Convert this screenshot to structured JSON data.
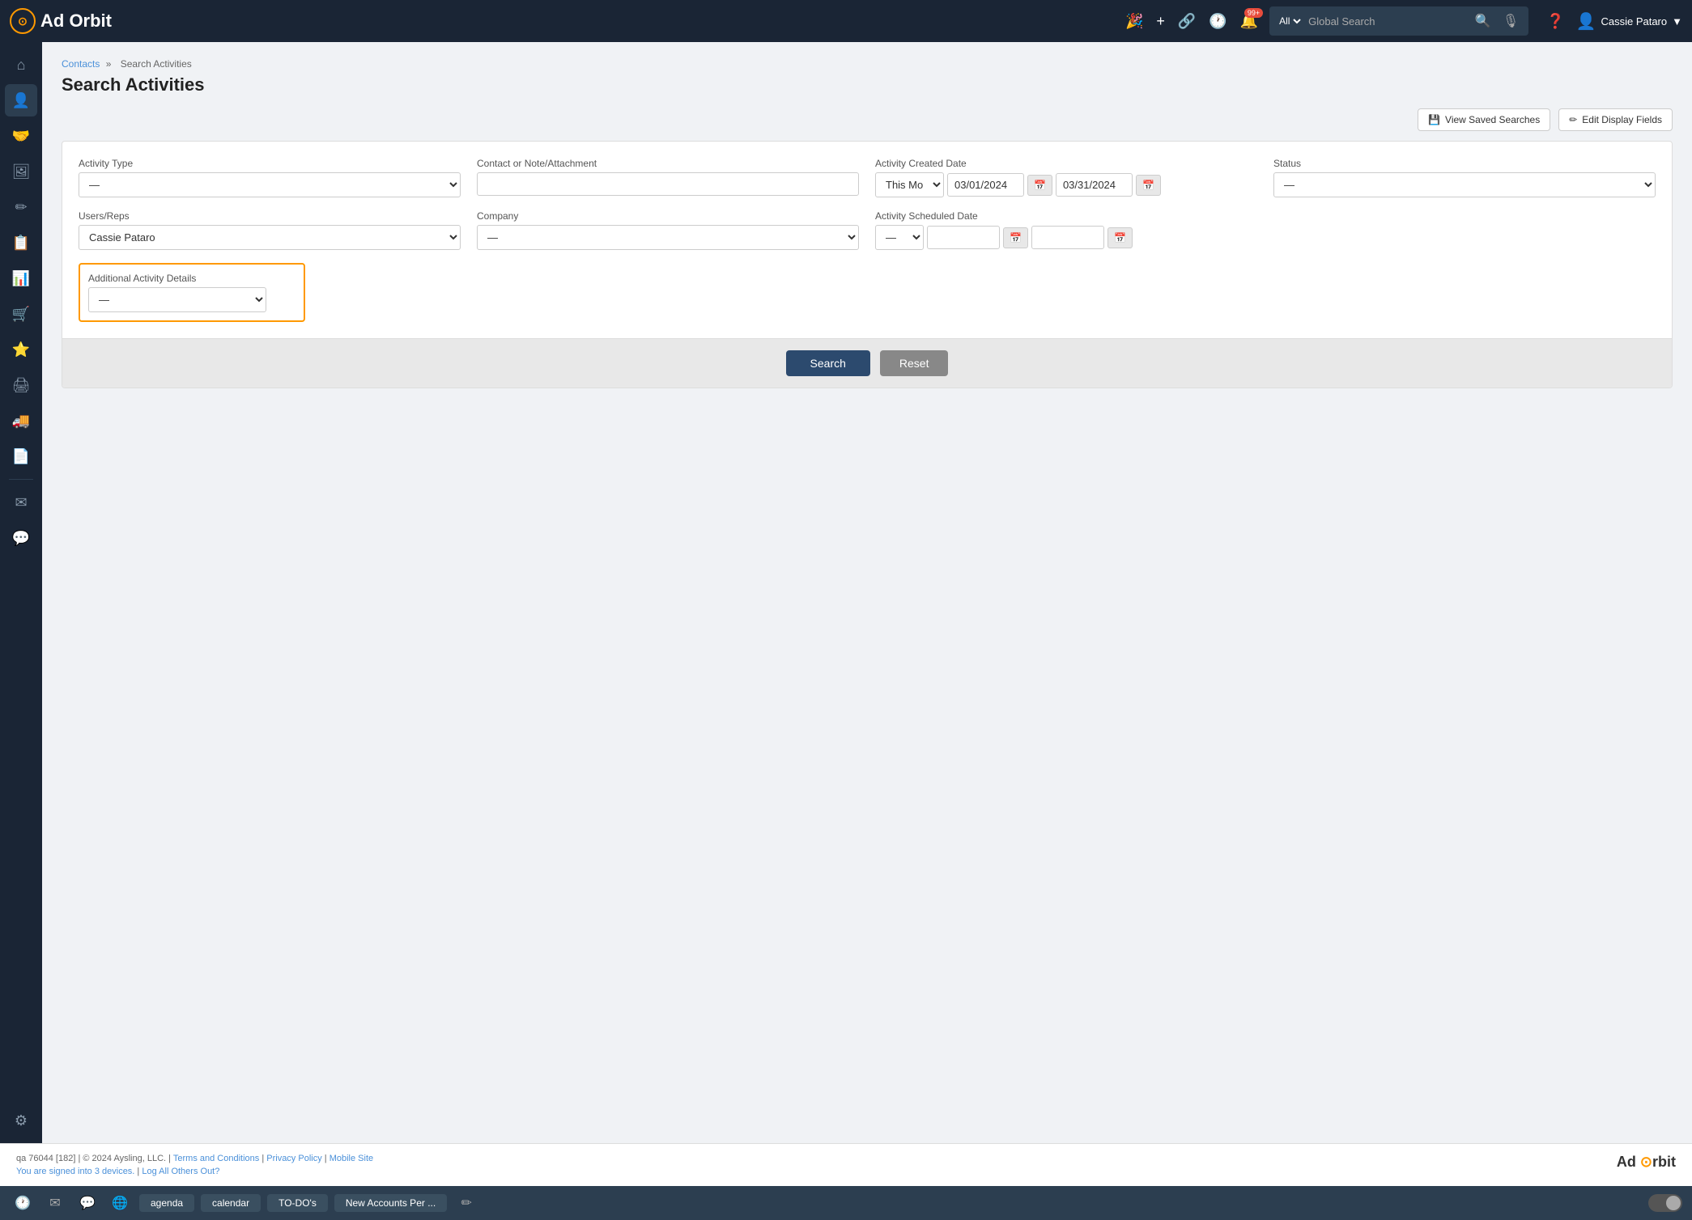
{
  "app": {
    "logo_text": "Ad Orbit",
    "logo_symbol": "⊙"
  },
  "topnav": {
    "search_placeholder": "Global Search",
    "search_filter": "All",
    "notification_count": "99+",
    "user_name": "Cassie Pataro",
    "help_icon": "?",
    "icons": [
      "🎉",
      "+",
      "🔗",
      "🕐"
    ]
  },
  "sidebar": {
    "items": [
      {
        "icon": "⌂",
        "name": "home",
        "active": false
      },
      {
        "icon": "👤",
        "name": "contacts",
        "active": true
      },
      {
        "icon": "🤝",
        "name": "deals",
        "active": false
      },
      {
        "icon": "🖼",
        "name": "media",
        "active": false
      },
      {
        "icon": "✏",
        "name": "edit",
        "active": false
      },
      {
        "icon": "📋",
        "name": "orders",
        "active": false
      },
      {
        "icon": "📊",
        "name": "reports",
        "active": false
      },
      {
        "icon": "🛒",
        "name": "cart",
        "active": false
      },
      {
        "icon": "⭐",
        "name": "favorites",
        "active": false
      },
      {
        "icon": "🖨",
        "name": "print",
        "active": false
      },
      {
        "icon": "🚚",
        "name": "delivery",
        "active": false
      },
      {
        "icon": "📄",
        "name": "document",
        "active": false
      },
      {
        "icon": "✉",
        "name": "mail",
        "active": false
      },
      {
        "icon": "💬",
        "name": "messages",
        "active": false
      },
      {
        "icon": "⚙",
        "name": "settings",
        "active": false
      }
    ]
  },
  "breadcrumb": {
    "parent": "Contacts",
    "separator": "»",
    "current": "Search Activities"
  },
  "page": {
    "title": "Search Activities"
  },
  "toolbar": {
    "view_saved_label": "View Saved Searches",
    "edit_display_label": "Edit Display Fields"
  },
  "form": {
    "activity_type": {
      "label": "Activity Type",
      "value": "—",
      "options": [
        "—"
      ]
    },
    "contact_note": {
      "label": "Contact or Note/Attachment",
      "placeholder": ""
    },
    "activity_created_date": {
      "label": "Activity Created Date",
      "preset": "This Mo",
      "start": "03/01/2024",
      "end": "03/31/2024"
    },
    "status": {
      "label": "Status",
      "value": "—",
      "options": [
        "—"
      ]
    },
    "users_reps": {
      "label": "Users/Reps",
      "value": "Cassie Pataro",
      "options": [
        "Cassie Pataro"
      ]
    },
    "company": {
      "label": "Company",
      "value": "—",
      "options": [
        "—"
      ]
    },
    "activity_scheduled_date": {
      "label": "Activity Scheduled Date",
      "preset": "—",
      "start": "",
      "end": ""
    },
    "additional_activity": {
      "label": "Additional Activity Details",
      "value": "—",
      "options": [
        "—"
      ]
    }
  },
  "actions": {
    "search_label": "Search",
    "reset_label": "Reset"
  },
  "footer": {
    "qa_text": "qa 76044 [182]",
    "copyright": "© 2024 Aysling, LLC.",
    "terms": "Terms and Conditions",
    "privacy": "Privacy Policy",
    "mobile": "Mobile Site",
    "signed_in": "You are signed into 3 devices.",
    "log_out": "Log All Others Out?"
  },
  "taskbar": {
    "tabs": [
      "agenda",
      "calendar",
      "TO-DO's",
      "New Accounts Per ..."
    ],
    "icons": [
      "🕐",
      "✉",
      "💬",
      "🌐"
    ]
  }
}
